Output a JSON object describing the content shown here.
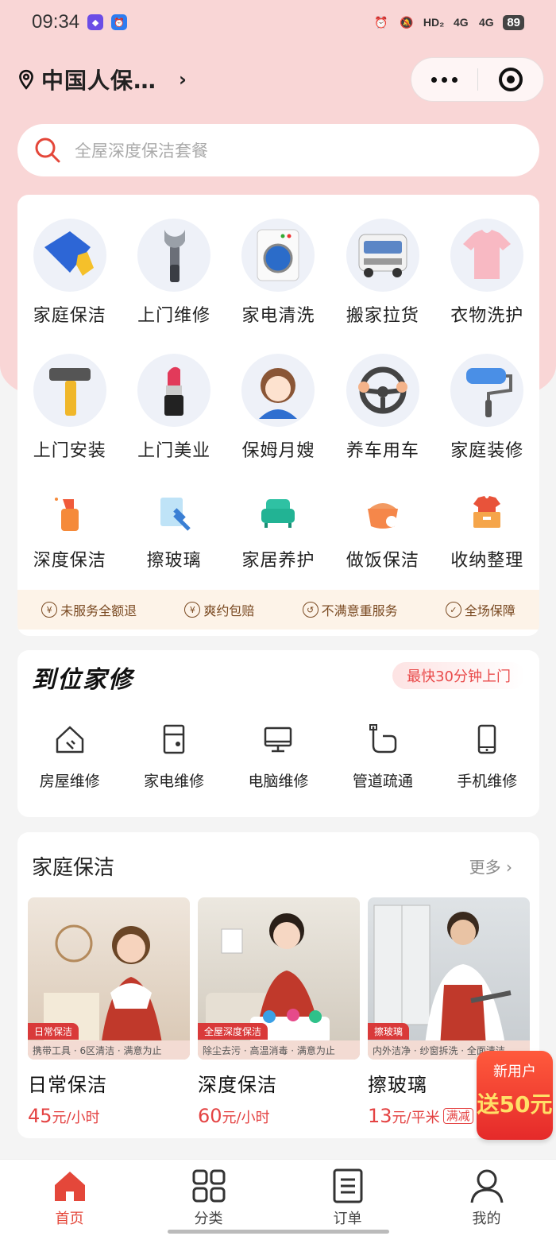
{
  "status_bar": {
    "time": "09:34",
    "battery": "89",
    "hd": "HD₂",
    "net1": "4G",
    "net2": "4G"
  },
  "header": {
    "location": "中国人保…"
  },
  "search": {
    "placeholder": "全屋深度保洁套餐"
  },
  "services": [
    {
      "label": "家庭保洁",
      "icon": "cleaning-cloth-icon"
    },
    {
      "label": "上门维修",
      "icon": "wrench-icon"
    },
    {
      "label": "家电清洗",
      "icon": "washing-machine-icon"
    },
    {
      "label": "搬家拉货",
      "icon": "van-icon"
    },
    {
      "label": "衣物洗护",
      "icon": "tshirt-icon"
    },
    {
      "label": "上门安装",
      "icon": "hammer-icon"
    },
    {
      "label": "上门美业",
      "icon": "lipstick-icon"
    },
    {
      "label": "保姆月嫂",
      "icon": "nanny-icon"
    },
    {
      "label": "养车用车",
      "icon": "steering-wheel-icon"
    },
    {
      "label": "家庭装修",
      "icon": "paint-roller-icon"
    }
  ],
  "services_small": [
    {
      "label": "深度保洁",
      "icon": "spray-bottle-icon"
    },
    {
      "label": "擦玻璃",
      "icon": "window-wiper-icon"
    },
    {
      "label": "家居养护",
      "icon": "sofa-icon"
    },
    {
      "label": "做饭保洁",
      "icon": "cooking-pot-icon"
    },
    {
      "label": "收纳整理",
      "icon": "storage-box-icon"
    }
  ],
  "guarantees": [
    {
      "label": "未服务全额退",
      "icon": "¥"
    },
    {
      "label": "爽约包赔",
      "icon": "¥"
    },
    {
      "label": "不满意重服务",
      "icon": "↺"
    },
    {
      "label": "全场保障",
      "icon": "✓"
    }
  ],
  "repair": {
    "logo": "到位家修",
    "badge": "最快30分钟上门",
    "items": [
      {
        "label": "房屋维修",
        "icon": "house-repair-icon"
      },
      {
        "label": "家电维修",
        "icon": "appliance-icon"
      },
      {
        "label": "电脑维修",
        "icon": "computer-icon"
      },
      {
        "label": "管道疏通",
        "icon": "pipe-icon"
      },
      {
        "label": "手机维修",
        "icon": "phone-icon"
      }
    ]
  },
  "cleaning": {
    "title": "家庭保洁",
    "more": "更多 ›",
    "products": [
      {
        "name": "日常保洁",
        "tag": "日常保洁",
        "desc": "携带工具 · 6区清洁 · 满意为止",
        "price": "45",
        "unit": "元/小时",
        "promo": ""
      },
      {
        "name": "深度保洁",
        "tag": "全屋深度保洁",
        "desc": "除尘去污 · 高温消毒 · 满意为止",
        "price": "60",
        "unit": "元/小时",
        "promo": ""
      },
      {
        "name": "擦玻璃",
        "tag": "擦玻璃",
        "desc": "内外洁净 · 纱窗拆洗 · 全面清洁",
        "price": "13",
        "unit": "元/平米",
        "promo": "满减"
      }
    ]
  },
  "new_user": {
    "line1": "新用户",
    "line2": "送50元"
  },
  "tabs": [
    {
      "label": "首页",
      "icon": "home-icon",
      "active": true
    },
    {
      "label": "分类",
      "icon": "grid-icon",
      "active": false
    },
    {
      "label": "订单",
      "icon": "order-list-icon",
      "active": false
    },
    {
      "label": "我的",
      "icon": "profile-icon",
      "active": false
    }
  ],
  "colors": {
    "accent": "#e4473a",
    "header_pink": "#f9d6d6",
    "guarantee_bg": "#fdf3e8"
  }
}
